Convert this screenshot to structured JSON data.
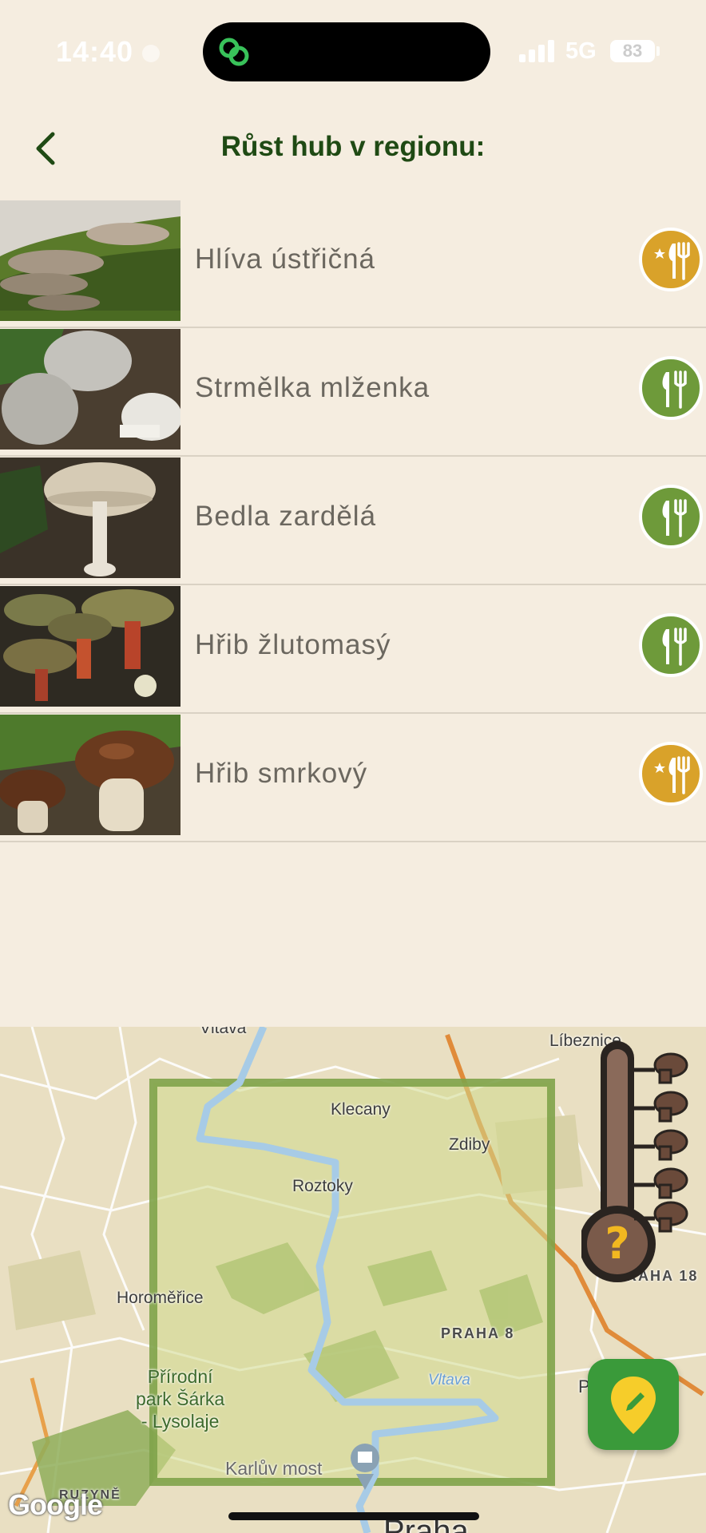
{
  "status": {
    "time": "14:40",
    "network": "5G",
    "battery": "83"
  },
  "header": {
    "title": "Růst hub v regionu:"
  },
  "mushrooms": [
    {
      "name": "Hlíva ústřičná",
      "edibility_icon": "fork-knife-star-icon",
      "badge_color": "#d9a22a"
    },
    {
      "name": "Strmělka mlženka",
      "edibility_icon": "fork-knife-icon",
      "badge_color": "#6e9a3a"
    },
    {
      "name": "Bedla zardělá",
      "edibility_icon": "fork-knife-icon",
      "badge_color": "#6e9a3a"
    },
    {
      "name": "Hřib žlutomasý",
      "edibility_icon": "fork-knife-icon",
      "badge_color": "#6e9a3a"
    },
    {
      "name": "Hřib smrkový",
      "edibility_icon": "fork-knife-star-icon",
      "badge_color": "#d9a22a"
    }
  ],
  "map": {
    "labels": {
      "vltava_top": "Vltava",
      "libeznice": "Líbeznice",
      "klecany": "Klecany",
      "zdiby": "Zdiby",
      "roztoky": "Roztoky",
      "horomerice": "Horoměřice",
      "praha18": "PRAHA 18",
      "praha8": "PRAHA 8",
      "park_line1": "Přírodní",
      "park_line2": "park Šárka",
      "park_line3": "- Lysolaje",
      "vltava": "Vltava",
      "karluv_most": "Karlův most",
      "ruzyne": "RUZYNĚ",
      "praha_big": "Praha",
      "p_edge": "P"
    },
    "attribution": "Google"
  },
  "colors": {
    "accent": "#1f4a14",
    "gold": "#d9a22a",
    "green": "#6e9a3a",
    "fab": "#3a9a3a"
  }
}
